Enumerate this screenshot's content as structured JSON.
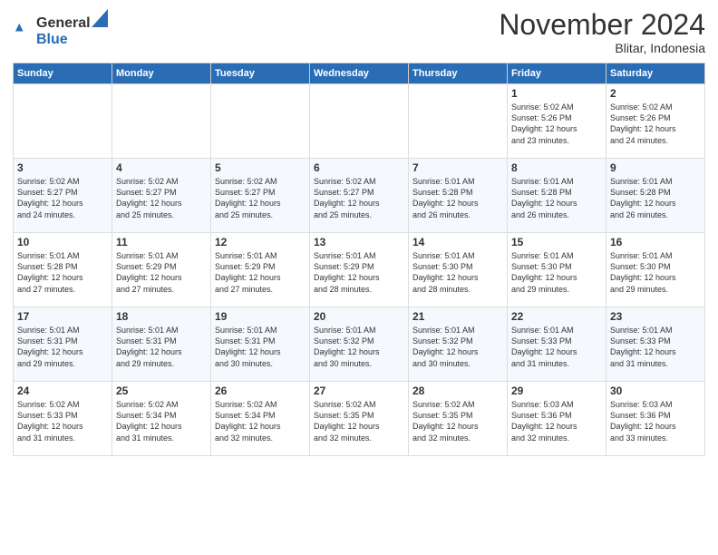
{
  "header": {
    "logo_general": "General",
    "logo_blue": "Blue",
    "month": "November 2024",
    "location": "Blitar, Indonesia"
  },
  "weekdays": [
    "Sunday",
    "Monday",
    "Tuesday",
    "Wednesday",
    "Thursday",
    "Friday",
    "Saturday"
  ],
  "weeks": [
    [
      {
        "day": "",
        "info": ""
      },
      {
        "day": "",
        "info": ""
      },
      {
        "day": "",
        "info": ""
      },
      {
        "day": "",
        "info": ""
      },
      {
        "day": "",
        "info": ""
      },
      {
        "day": "1",
        "info": "Sunrise: 5:02 AM\nSunset: 5:26 PM\nDaylight: 12 hours\nand 23 minutes."
      },
      {
        "day": "2",
        "info": "Sunrise: 5:02 AM\nSunset: 5:26 PM\nDaylight: 12 hours\nand 24 minutes."
      }
    ],
    [
      {
        "day": "3",
        "info": "Sunrise: 5:02 AM\nSunset: 5:27 PM\nDaylight: 12 hours\nand 24 minutes."
      },
      {
        "day": "4",
        "info": "Sunrise: 5:02 AM\nSunset: 5:27 PM\nDaylight: 12 hours\nand 25 minutes."
      },
      {
        "day": "5",
        "info": "Sunrise: 5:02 AM\nSunset: 5:27 PM\nDaylight: 12 hours\nand 25 minutes."
      },
      {
        "day": "6",
        "info": "Sunrise: 5:02 AM\nSunset: 5:27 PM\nDaylight: 12 hours\nand 25 minutes."
      },
      {
        "day": "7",
        "info": "Sunrise: 5:01 AM\nSunset: 5:28 PM\nDaylight: 12 hours\nand 26 minutes."
      },
      {
        "day": "8",
        "info": "Sunrise: 5:01 AM\nSunset: 5:28 PM\nDaylight: 12 hours\nand 26 minutes."
      },
      {
        "day": "9",
        "info": "Sunrise: 5:01 AM\nSunset: 5:28 PM\nDaylight: 12 hours\nand 26 minutes."
      }
    ],
    [
      {
        "day": "10",
        "info": "Sunrise: 5:01 AM\nSunset: 5:28 PM\nDaylight: 12 hours\nand 27 minutes."
      },
      {
        "day": "11",
        "info": "Sunrise: 5:01 AM\nSunset: 5:29 PM\nDaylight: 12 hours\nand 27 minutes."
      },
      {
        "day": "12",
        "info": "Sunrise: 5:01 AM\nSunset: 5:29 PM\nDaylight: 12 hours\nand 27 minutes."
      },
      {
        "day": "13",
        "info": "Sunrise: 5:01 AM\nSunset: 5:29 PM\nDaylight: 12 hours\nand 28 minutes."
      },
      {
        "day": "14",
        "info": "Sunrise: 5:01 AM\nSunset: 5:30 PM\nDaylight: 12 hours\nand 28 minutes."
      },
      {
        "day": "15",
        "info": "Sunrise: 5:01 AM\nSunset: 5:30 PM\nDaylight: 12 hours\nand 29 minutes."
      },
      {
        "day": "16",
        "info": "Sunrise: 5:01 AM\nSunset: 5:30 PM\nDaylight: 12 hours\nand 29 minutes."
      }
    ],
    [
      {
        "day": "17",
        "info": "Sunrise: 5:01 AM\nSunset: 5:31 PM\nDaylight: 12 hours\nand 29 minutes."
      },
      {
        "day": "18",
        "info": "Sunrise: 5:01 AM\nSunset: 5:31 PM\nDaylight: 12 hours\nand 29 minutes."
      },
      {
        "day": "19",
        "info": "Sunrise: 5:01 AM\nSunset: 5:31 PM\nDaylight: 12 hours\nand 30 minutes."
      },
      {
        "day": "20",
        "info": "Sunrise: 5:01 AM\nSunset: 5:32 PM\nDaylight: 12 hours\nand 30 minutes."
      },
      {
        "day": "21",
        "info": "Sunrise: 5:01 AM\nSunset: 5:32 PM\nDaylight: 12 hours\nand 30 minutes."
      },
      {
        "day": "22",
        "info": "Sunrise: 5:01 AM\nSunset: 5:33 PM\nDaylight: 12 hours\nand 31 minutes."
      },
      {
        "day": "23",
        "info": "Sunrise: 5:01 AM\nSunset: 5:33 PM\nDaylight: 12 hours\nand 31 minutes."
      }
    ],
    [
      {
        "day": "24",
        "info": "Sunrise: 5:02 AM\nSunset: 5:33 PM\nDaylight: 12 hours\nand 31 minutes."
      },
      {
        "day": "25",
        "info": "Sunrise: 5:02 AM\nSunset: 5:34 PM\nDaylight: 12 hours\nand 31 minutes."
      },
      {
        "day": "26",
        "info": "Sunrise: 5:02 AM\nSunset: 5:34 PM\nDaylight: 12 hours\nand 32 minutes."
      },
      {
        "day": "27",
        "info": "Sunrise: 5:02 AM\nSunset: 5:35 PM\nDaylight: 12 hours\nand 32 minutes."
      },
      {
        "day": "28",
        "info": "Sunrise: 5:02 AM\nSunset: 5:35 PM\nDaylight: 12 hours\nand 32 minutes."
      },
      {
        "day": "29",
        "info": "Sunrise: 5:03 AM\nSunset: 5:36 PM\nDaylight: 12 hours\nand 32 minutes."
      },
      {
        "day": "30",
        "info": "Sunrise: 5:03 AM\nSunset: 5:36 PM\nDaylight: 12 hours\nand 33 minutes."
      }
    ]
  ]
}
